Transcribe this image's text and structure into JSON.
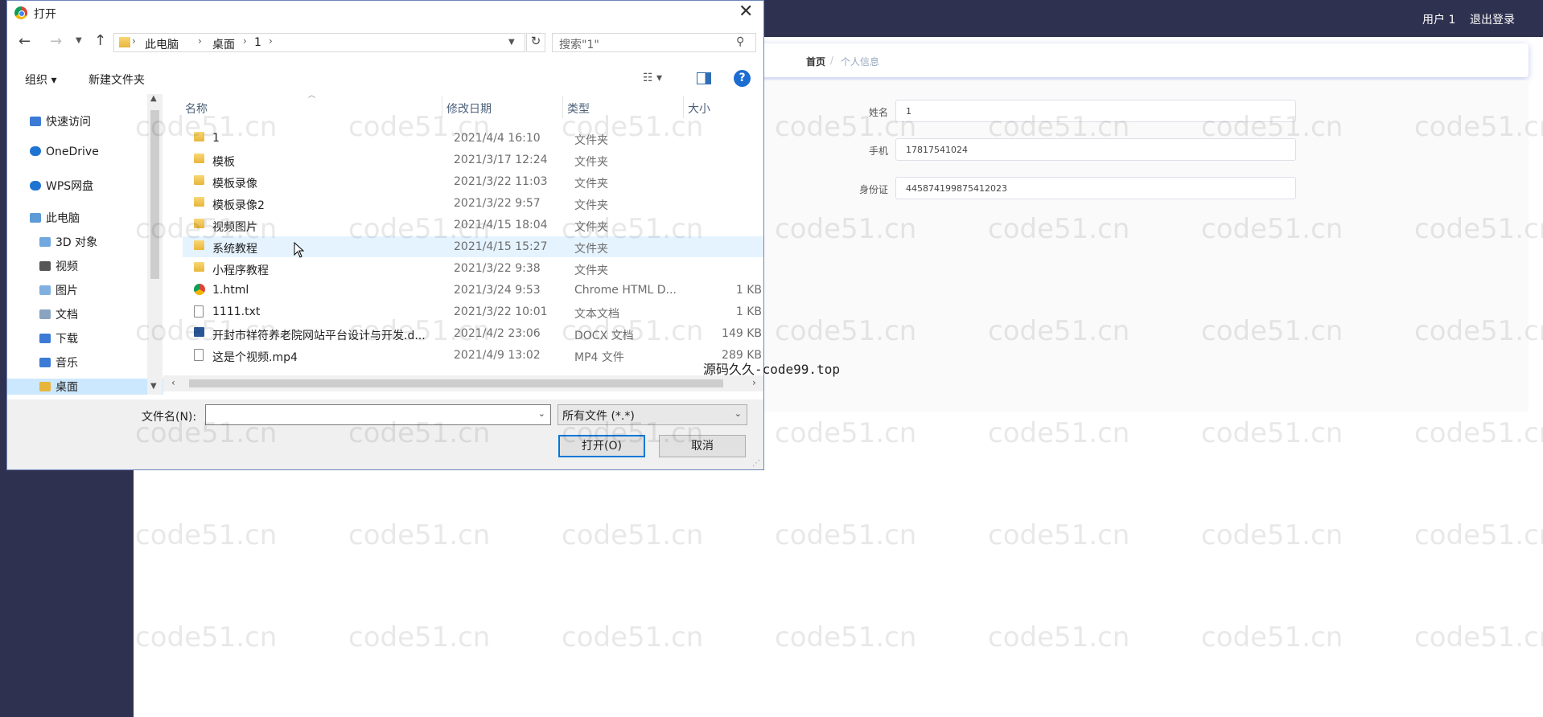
{
  "app": {
    "top_user": "用户 1",
    "top_logout": "退出登录",
    "breadcrumb_home": "首页",
    "breadcrumb_sep": "/",
    "breadcrumb_current": "个人信息",
    "fields": [
      {
        "label": "姓名",
        "value": "1"
      },
      {
        "label": "手机",
        "value": "17817541024"
      },
      {
        "label": "身份证",
        "value": "445874199875412023"
      }
    ],
    "overlay_text": "源码久久-code99.top",
    "watermark": "code51.cn"
  },
  "dialog": {
    "title": "打开",
    "path": [
      "此电脑",
      "桌面",
      "1"
    ],
    "search_placeholder": "搜索\"1\"",
    "organize": "组织",
    "new_folder": "新建文件夹",
    "help": "?",
    "nav": [
      {
        "label": "快速访问",
        "icon": "star-icon"
      },
      {
        "label": "OneDrive",
        "icon": "cloud-icon"
      },
      {
        "label": "WPS网盘",
        "icon": "cloud-icon"
      },
      {
        "label": "此电脑",
        "icon": "computer-icon"
      },
      {
        "label": "3D 对象",
        "icon": "cube-icon"
      },
      {
        "label": "视频",
        "icon": "video-icon"
      },
      {
        "label": "图片",
        "icon": "picture-icon"
      },
      {
        "label": "文档",
        "icon": "document-icon"
      },
      {
        "label": "下载",
        "icon": "download-icon"
      },
      {
        "label": "音乐",
        "icon": "music-icon"
      },
      {
        "label": "桌面",
        "icon": "folder-icon"
      }
    ],
    "columns": {
      "name": "名称",
      "date": "修改日期",
      "type": "类型",
      "size": "大小"
    },
    "files": [
      {
        "name": "1",
        "date": "2021/4/4 16:10",
        "type": "文件夹",
        "size": "",
        "icon": "folder-icon"
      },
      {
        "name": "模板",
        "date": "2021/3/17 12:24",
        "type": "文件夹",
        "size": "",
        "icon": "folder-icon"
      },
      {
        "name": "模板录像",
        "date": "2021/3/22 11:03",
        "type": "文件夹",
        "size": "",
        "icon": "folder-icon"
      },
      {
        "name": "模板录像2",
        "date": "2021/3/22 9:57",
        "type": "文件夹",
        "size": "",
        "icon": "folder-icon"
      },
      {
        "name": "视频图片",
        "date": "2021/4/15 18:04",
        "type": "文件夹",
        "size": "",
        "icon": "folder-icon"
      },
      {
        "name": "系统教程",
        "date": "2021/4/15 15:27",
        "type": "文件夹",
        "size": "",
        "icon": "folder-icon"
      },
      {
        "name": "小程序教程",
        "date": "2021/3/22 9:38",
        "type": "文件夹",
        "size": "",
        "icon": "folder-icon"
      },
      {
        "name": "1.html",
        "date": "2021/3/24 9:53",
        "type": "Chrome HTML D...",
        "size": "1 KB",
        "icon": "chrome-icon"
      },
      {
        "name": "1111.txt",
        "date": "2021/3/22 10:01",
        "type": "文本文档",
        "size": "1 KB",
        "icon": "text-file-icon"
      },
      {
        "name": "开封市祥符养老院网站平台设计与开发.d...",
        "date": "2021/4/2 23:06",
        "type": "DOCX 文档",
        "size": "149 KB",
        "icon": "word-icon"
      },
      {
        "name": "这是个视频.mp4",
        "date": "2021/4/9 13:02",
        "type": "MP4 文件",
        "size": "289 KB",
        "icon": "video-file-icon"
      }
    ],
    "hovered_index": 5,
    "filename_label": "文件名(N):",
    "filename_value": "",
    "filter": "所有文件 (*.*)",
    "open_button": "打开(O)",
    "cancel_button": "取消"
  }
}
